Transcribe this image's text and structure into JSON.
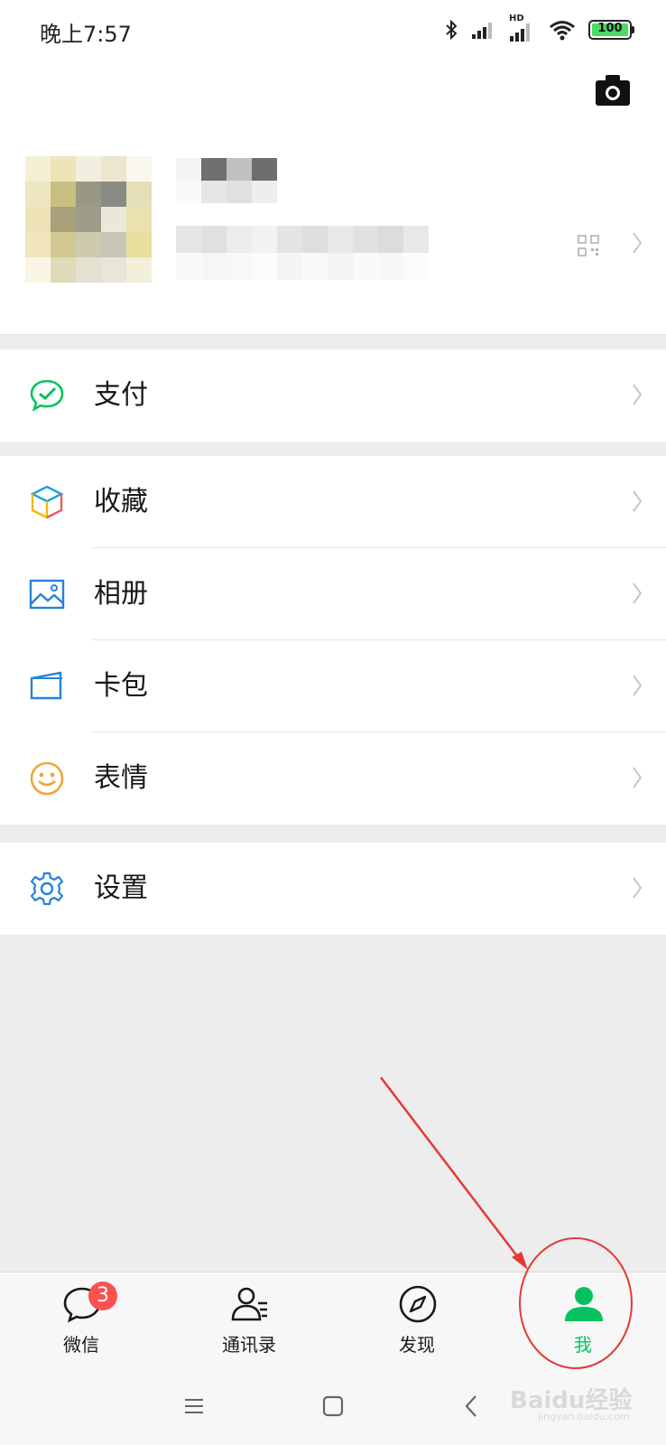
{
  "status_bar": {
    "time": "晚上7:57",
    "icons": [
      "bluetooth-icon",
      "signal-icon",
      "hd-signal-icon",
      "wifi-icon"
    ],
    "hd_label": "HD",
    "battery": "100"
  },
  "profile": {
    "camera_icon": "camera-icon",
    "qr_icon": "qr-code-icon"
  },
  "menu_groups": [
    [
      {
        "label": "支付",
        "icon": "wechat-pay-icon"
      }
    ],
    [
      {
        "label": "收藏",
        "icon": "favorites-cube-icon"
      },
      {
        "label": "相册",
        "icon": "album-picture-icon"
      },
      {
        "label": "卡包",
        "icon": "card-wallet-icon"
      },
      {
        "label": "表情",
        "icon": "smiley-icon"
      }
    ],
    [
      {
        "label": "设置",
        "icon": "settings-gear-icon"
      }
    ]
  ],
  "tabs": [
    {
      "label": "微信",
      "icon": "chat-bubble-icon",
      "badge": "3"
    },
    {
      "label": "通讯录",
      "icon": "contacts-icon"
    },
    {
      "label": "发现",
      "icon": "compass-icon"
    },
    {
      "label": "我",
      "icon": "person-icon",
      "active": true
    }
  ],
  "colors": {
    "accent": "#07c160",
    "badge": "#fa5151",
    "annotation": "#e53935"
  },
  "watermark": {
    "text": "Baidu经验",
    "sub": "jingyan.baidu.com"
  }
}
